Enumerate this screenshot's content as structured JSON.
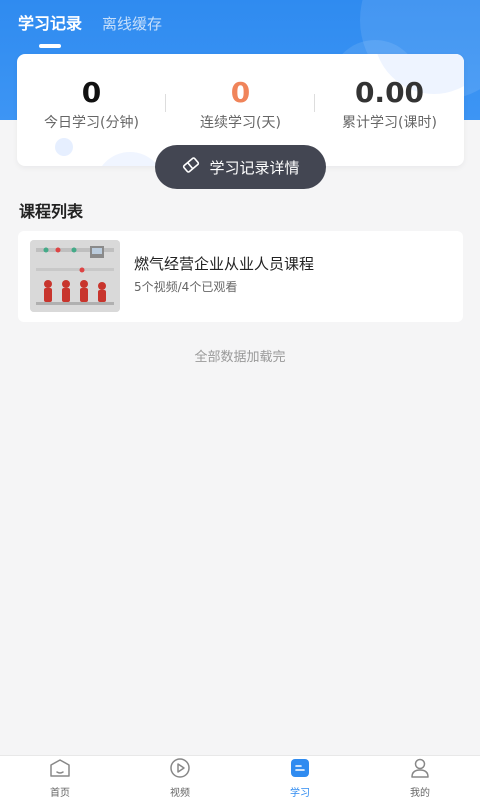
{
  "colors": {
    "primary": "#2f8bf0",
    "orange": "#f0845a",
    "dark_button": "#434652"
  },
  "tabs": [
    {
      "label": "学习记录",
      "active": true
    },
    {
      "label": "离线缓存",
      "active": false
    }
  ],
  "stats": [
    {
      "value": "0",
      "label": "今日学习(分钟)"
    },
    {
      "value": "0",
      "label": "连续学习(天)"
    },
    {
      "value": "0.00",
      "label": "累计学习(课时)"
    }
  ],
  "detail_button": {
    "label": "学习记录详情",
    "icon": "eraser-icon"
  },
  "section": {
    "title": "课程列表"
  },
  "courses": [
    {
      "title": "燃气经营企业从业人员课程",
      "subtitle": "5个视频/4个已观看"
    }
  ],
  "load_status": "全部数据加载完",
  "bottom_nav": [
    {
      "label": "首页",
      "icon": "home-icon"
    },
    {
      "label": "视频",
      "icon": "play-icon"
    },
    {
      "label": "学习",
      "icon": "study-icon",
      "active": true
    },
    {
      "label": "我的",
      "icon": "user-icon"
    }
  ]
}
